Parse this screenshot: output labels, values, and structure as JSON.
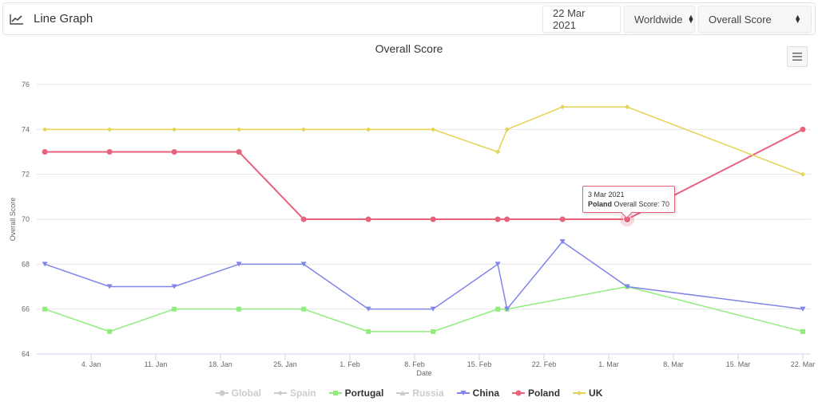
{
  "header": {
    "icon": "line-chart-icon",
    "title": "Line Graph",
    "date_value": "22 Mar 2021",
    "region_select": "Worldwide",
    "metric_select": "Overall Score"
  },
  "menu_icon": "hamburger-menu-icon",
  "tooltip": {
    "date": "3 Mar 2021",
    "series": "Poland",
    "label": "Overall Score: 70"
  },
  "chart_data": {
    "type": "line",
    "title": "Overall Score",
    "xlabel": "Date",
    "ylabel": "Overall Score",
    "ylim": [
      64,
      76
    ],
    "yticks": [
      64,
      66,
      68,
      70,
      72,
      74,
      76
    ],
    "xticks": [
      "4. Jan",
      "11. Jan",
      "18. Jan",
      "25. Jan",
      "1. Feb",
      "8. Feb",
      "15. Feb",
      "22. Feb",
      "1. Mar",
      "8. Mar",
      "15. Mar",
      "22. Mar"
    ],
    "x": [
      "2020-12-30",
      "2021-01-06",
      "2021-01-13",
      "2021-01-20",
      "2021-01-27",
      "2021-02-03",
      "2021-02-10",
      "2021-02-17",
      "2021-02-18",
      "2021-02-24",
      "2021-03-03",
      "2021-03-22"
    ],
    "grid": true,
    "legend_position": "bottom-center",
    "series": [
      {
        "name": "Global",
        "visible": false,
        "color": "#cccccc",
        "marker": "circle",
        "values": []
      },
      {
        "name": "Spain",
        "visible": false,
        "color": "#cccccc",
        "marker": "diamond",
        "values": []
      },
      {
        "name": "Portugal",
        "visible": true,
        "color": "#90ed7d",
        "marker": "square",
        "values": [
          66,
          65,
          66,
          66,
          66,
          65,
          65,
          66,
          66,
          null,
          67,
          65
        ]
      },
      {
        "name": "Russia",
        "visible": false,
        "color": "#cccccc",
        "marker": "triangle",
        "values": []
      },
      {
        "name": "China",
        "visible": true,
        "color": "#8085e9",
        "marker": "triangle-down",
        "values": [
          68,
          67,
          67,
          68,
          68,
          66,
          66,
          68,
          66,
          69,
          67,
          66
        ]
      },
      {
        "name": "Poland",
        "visible": true,
        "color": "#e8627c",
        "marker": "circle",
        "values": [
          73,
          73,
          73,
          73,
          70,
          70,
          70,
          70,
          70,
          70,
          70,
          74
        ]
      },
      {
        "name": "UK",
        "visible": true,
        "color": "#e4d354",
        "marker": "diamond",
        "values": [
          74,
          74,
          74,
          74,
          74,
          74,
          74,
          73,
          74,
          75,
          75,
          72
        ]
      }
    ]
  }
}
